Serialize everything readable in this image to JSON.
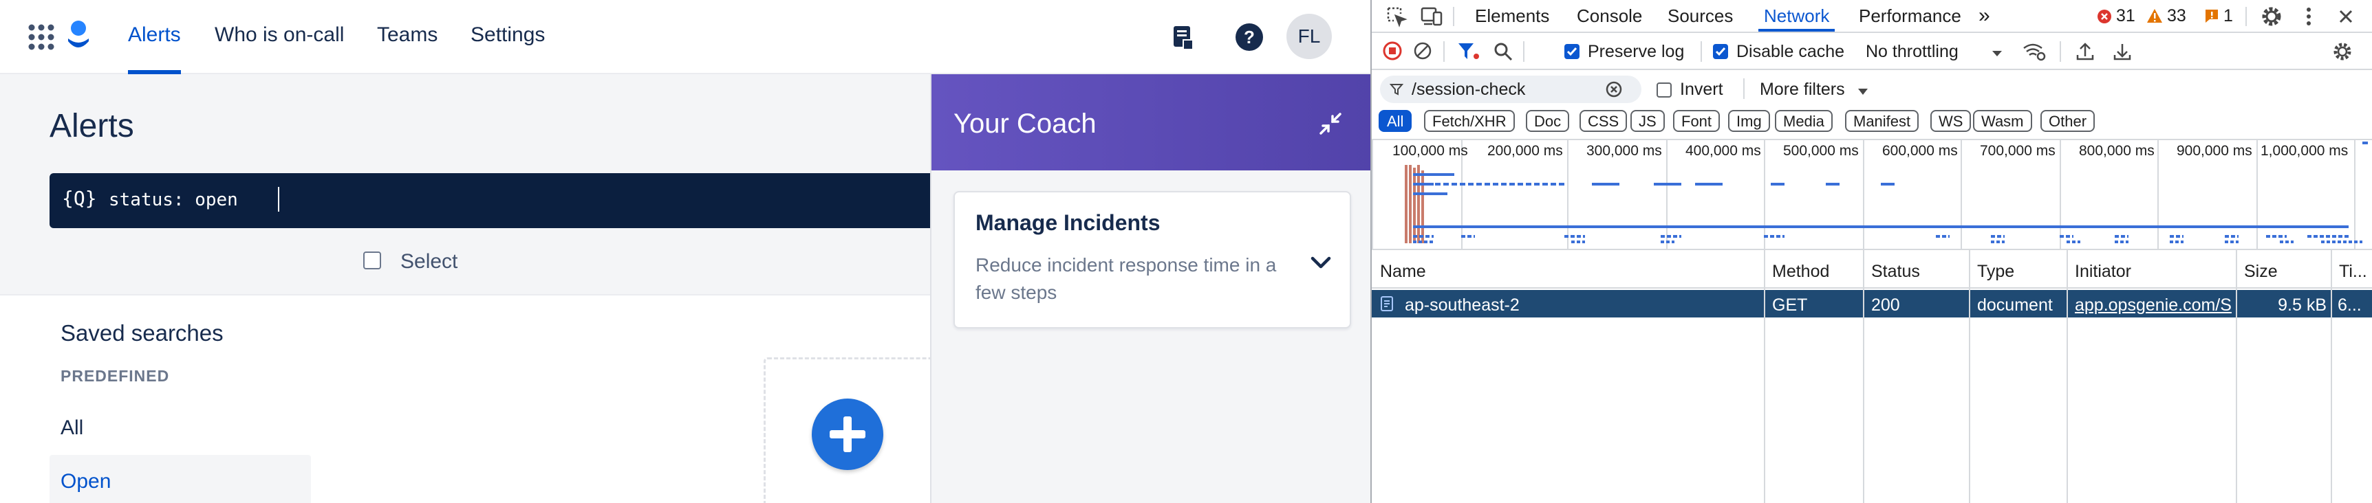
{
  "app": {
    "nav": {
      "items": [
        {
          "label": "Alerts",
          "active": true
        },
        {
          "label": "Who is on-call",
          "active": false
        },
        {
          "label": "Teams",
          "active": false
        },
        {
          "label": "Settings",
          "active": false
        }
      ],
      "avatar_initials": "FL"
    },
    "page_title": "Alerts",
    "search_query": "status: open",
    "search_icon_glyph": "{Q}",
    "select_label": "Select",
    "saved_searches": {
      "title": "Saved searches",
      "section_label": "PREDEFINED",
      "items": [
        {
          "label": "All",
          "selected": false
        },
        {
          "label": "Open",
          "selected": true
        }
      ]
    },
    "coach": {
      "title": "Your Coach",
      "card_title": "Manage Incidents",
      "card_desc": "Reduce incident response time in a few steps"
    }
  },
  "devtools": {
    "tabs": [
      "Elements",
      "Console",
      "Sources",
      "Network",
      "Performance"
    ],
    "active_tab": "Network",
    "more_tabs": "»",
    "error_count": "31",
    "warning_count": "33",
    "info_count": "1",
    "toolbar": {
      "preserve_log": "Preserve log",
      "preserve_log_checked": true,
      "disable_cache": "Disable cache",
      "disable_cache_checked": true,
      "throttling": "No throttling"
    },
    "filter": {
      "value": "/session-check",
      "invert": "Invert",
      "invert_checked": false,
      "more_filters": "More filters"
    },
    "type_filters": [
      "All",
      "Fetch/XHR",
      "Doc",
      "CSS",
      "JS",
      "Font",
      "Img",
      "Media",
      "Manifest",
      "WS",
      "Wasm",
      "Other"
    ],
    "active_type": "All",
    "timeline_ticks": [
      "100,000 ms",
      "200,000 ms",
      "300,000 ms",
      "400,000 ms",
      "500,000 ms",
      "600,000 ms",
      "700,000 ms",
      "800,000 ms",
      "900,000 ms",
      "1,000,000 ms"
    ],
    "table": {
      "columns": [
        "Name",
        "Method",
        "Status",
        "Type",
        "Initiator",
        "Size",
        "Ti..."
      ],
      "rows": [
        {
          "name": "ap-southeast-2",
          "method": "GET",
          "status": "200",
          "type": "document",
          "initiator": "app.opsgenie.com/S",
          "size": "9.5 kB",
          "time": "6..."
        }
      ]
    }
  },
  "colors": {
    "brand_blue": "#0052cc",
    "nav_search_bg": "#0b1f3f",
    "coach_purple": "#5e4db2",
    "devtools_accent": "#0b57d0",
    "selected_row": "#1f4a73"
  }
}
